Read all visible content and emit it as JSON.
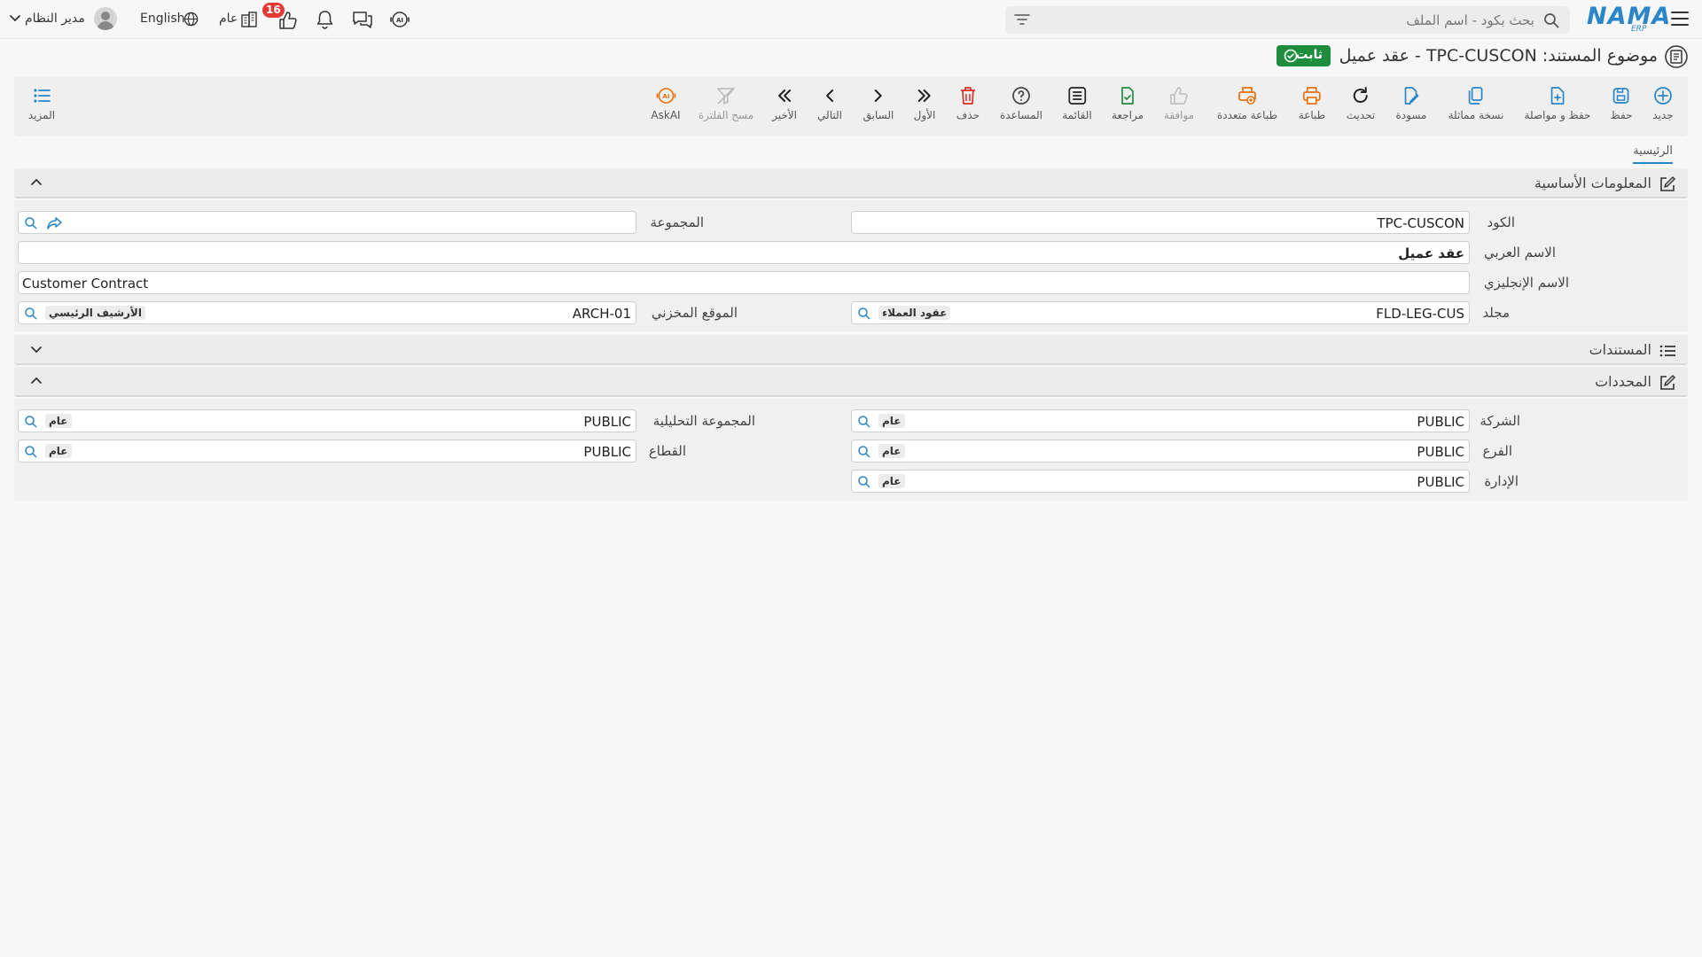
{
  "topbar": {
    "search_placeholder": "بحث بكود - اسم الملف",
    "logo_text": "NAMA",
    "logo_sub": "ERP",
    "user_name": "مدير النظام",
    "language": "English",
    "scope": "عام",
    "approvals_count": "16"
  },
  "title": {
    "text": "موضوع المستند: TPC-CUSCON - عقد عميل",
    "status": "ثابت"
  },
  "toolbar": {
    "new": "جديد",
    "save": "حفظ",
    "save_continue": "حفظ و مواصلة",
    "duplicate": "نسخة مماثلة",
    "draft": "مسودة",
    "refresh": "تحديث",
    "print": "طباعة",
    "multi_print": "طباعة متعددة",
    "approve": "موافقة",
    "review": "مراجعة",
    "list": "القائمة",
    "help": "المساعدة",
    "delete": "حذف",
    "first": "الأول",
    "previous": "السابق",
    "next": "التالي",
    "last": "الأخير",
    "clear_filter": "مسح الفلترة",
    "ask_ai": "AskAI",
    "more": "المزيد"
  },
  "tabs": {
    "main": "الرئيسية"
  },
  "basic_info": {
    "title": "المعلومات الأساسية",
    "code_label": "الكود",
    "code_value": "TPC-CUSCON",
    "group_label": "المجموعة",
    "arabic_name_label": "الاسم العربي",
    "arabic_name_value": "عقد عميل",
    "english_name_label": "الاسم الإنجليزي",
    "english_name_value": "Customer Contract",
    "folder_label": "مجلد",
    "folder_code": "FLD-LEG-CUS",
    "folder_name": "عقود العملاء",
    "storage_label": "الموقع المخزني",
    "storage_code": "ARCH-01",
    "storage_name": "الأرشيف الرئيسي"
  },
  "documents": {
    "title": "المستندات"
  },
  "dimensions": {
    "title": "المحددات",
    "company_label": "الشركة",
    "company_code": "PUBLIC",
    "company_name": "عام",
    "analytic_group_label": "المجموعة التحليلية",
    "analytic_group_code": "PUBLIC",
    "analytic_group_name": "عام",
    "branch_label": "الفرع",
    "branch_code": "PUBLIC",
    "branch_name": "عام",
    "sector_label": "القطاع",
    "sector_code": "PUBLIC",
    "sector_name": "عام",
    "department_label": "الإدارة",
    "department_code": "PUBLIC",
    "department_name": "عام"
  },
  "colors": {
    "accent_blue": "#2a86c8",
    "success_green": "#1e8e3e",
    "danger_red": "#d93025",
    "warning_orange": "#e8710a"
  }
}
